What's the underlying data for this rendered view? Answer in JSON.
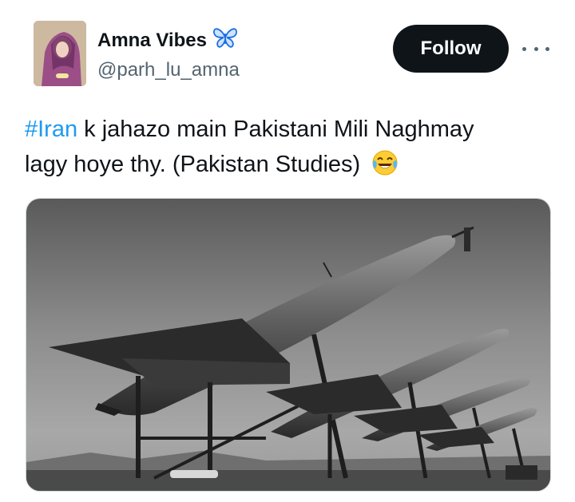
{
  "author": {
    "display_name": "Amna Vibes",
    "handle": "@parh_lu_amna",
    "badge_icon": "butterfly-icon"
  },
  "actions": {
    "follow_label": "Follow",
    "more_icon": "more-horizontal-icon"
  },
  "tweet": {
    "hashtag": "#Iran",
    "text_line1": " k jahazo main Pakistani Mili Naghmay",
    "text_line2": "lagy hoye thy. (Pakistan Studies)",
    "emoji": "tears-of-joy-emoji"
  },
  "media": {
    "type": "photo",
    "description_icon": "drone-photo"
  },
  "colors": {
    "hashtag": "#1d9bf0",
    "follow_bg": "#0f1419",
    "handle": "#536471",
    "butterfly": "#1d6fe0"
  }
}
